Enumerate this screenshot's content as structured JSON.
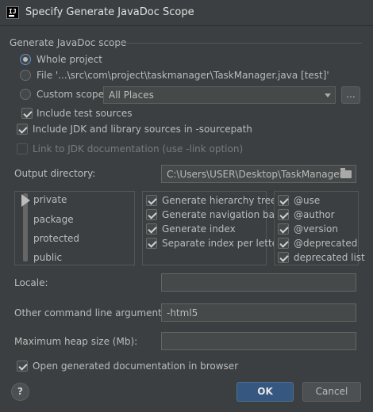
{
  "window": {
    "title": "Specify Generate JavaDoc Scope"
  },
  "scope": {
    "section_label": "Generate JavaDoc scope",
    "whole_project": "Whole project",
    "file": "File '...\\src\\com\\project\\taskmanager\\TaskManager.java [test]'",
    "custom_scope": "Custom scope",
    "custom_scope_value": "All Places",
    "browse_button": "...",
    "include_test_sources": "Include test sources",
    "selected": "Whole project"
  },
  "options": {
    "include_jdk": "Include JDK and library sources in -sourcepath",
    "link_jdk": "Link to JDK documentation (use -link option)"
  },
  "output": {
    "label": "Output directory:",
    "value": "C:\\Users\\USER\\Desktop\\TaskManager"
  },
  "visibility": {
    "levels": [
      "private",
      "package",
      "protected",
      "public"
    ],
    "selected": "private"
  },
  "generation": {
    "items": [
      "Generate hierarchy tree",
      "Generate navigation bar",
      "Generate index",
      "Separate index per letter"
    ]
  },
  "tags": {
    "items": [
      "@use",
      "@author",
      "@version",
      "@deprecated",
      "deprecated list"
    ]
  },
  "locale": {
    "label": "Locale:",
    "value": ""
  },
  "args": {
    "label": "Other command line arguments:",
    "value": "-html5"
  },
  "heap": {
    "label": "Maximum heap size (Mb):",
    "value": ""
  },
  "open_browser": "Open generated documentation in browser",
  "buttons": {
    "help": "?",
    "ok": "OK",
    "cancel": "Cancel"
  }
}
